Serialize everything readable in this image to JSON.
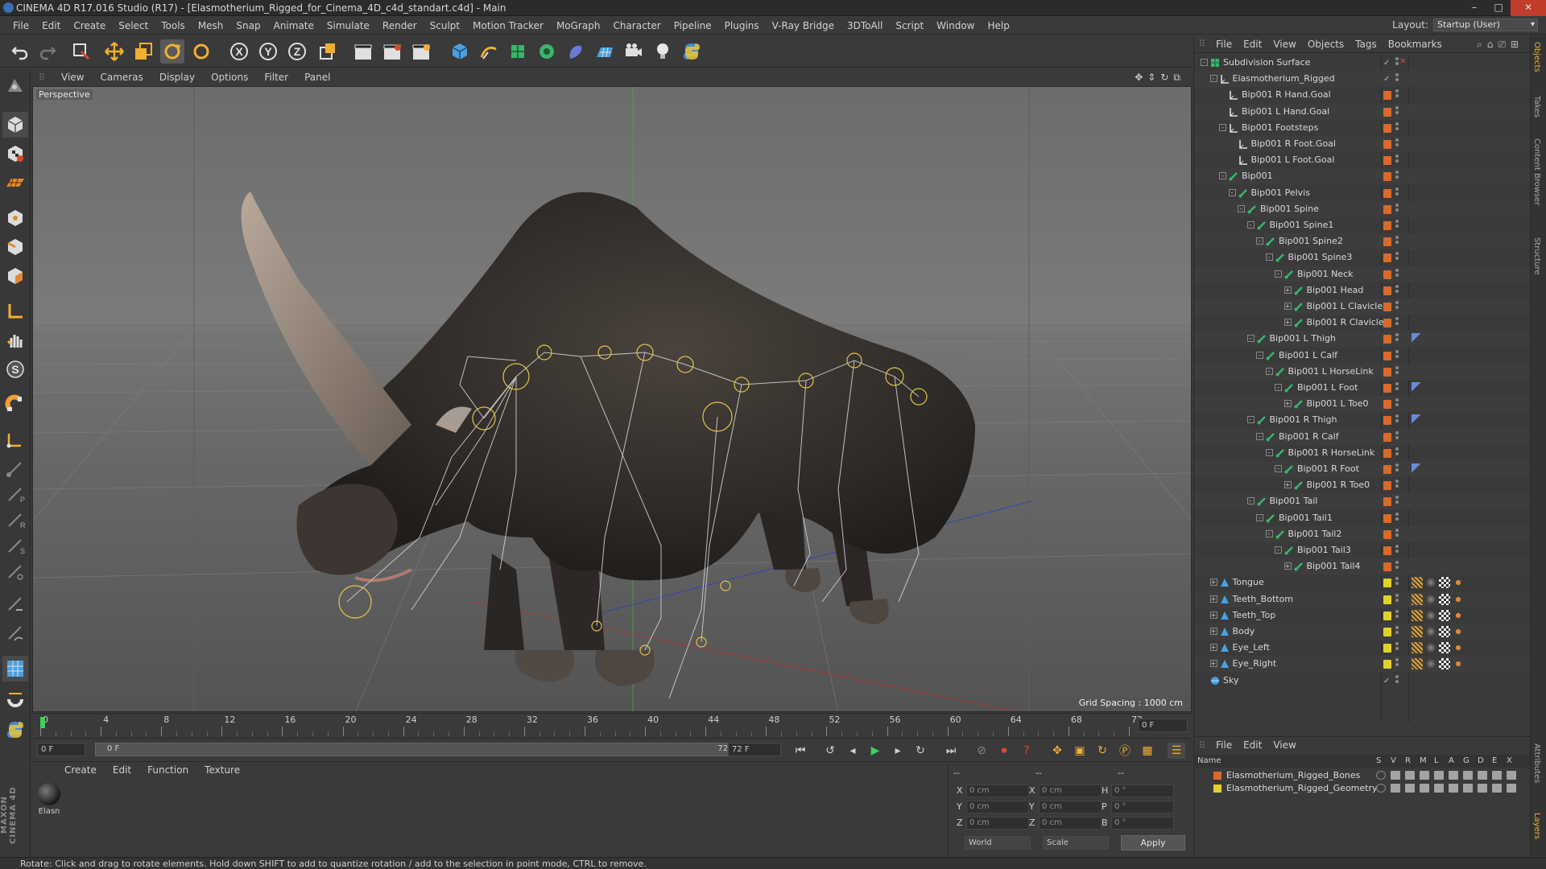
{
  "window": {
    "title": "CINEMA 4D R17.016 Studio (R17) - [Elasmotherium_Rigged_for_Cinema_4D_c4d_standart.c4d] - Main",
    "layout_label": "Layout:",
    "layout_value": "Startup (User)"
  },
  "menubar": [
    "File",
    "Edit",
    "Create",
    "Select",
    "Tools",
    "Mesh",
    "Snap",
    "Animate",
    "Simulate",
    "Render",
    "Sculpt",
    "Motion Tracker",
    "MoGraph",
    "Character",
    "Pipeline",
    "Plugins",
    "V-Ray Bridge",
    "3DToAll",
    "Script",
    "Window",
    "Help"
  ],
  "viewport": {
    "menu": [
      "View",
      "Cameras",
      "Display",
      "Options",
      "Filter",
      "Panel"
    ],
    "label": "Perspective",
    "grid_spacing": "Grid Spacing : 1000 cm"
  },
  "timeline": {
    "ticks": [
      "0",
      "4",
      "8",
      "12",
      "16",
      "20",
      "24",
      "28",
      "32",
      "36",
      "40",
      "44",
      "48",
      "52",
      "56",
      "60",
      "64",
      "68",
      "72"
    ],
    "current_frame_field": "0 F",
    "start_field": "0 F",
    "range_start": "0 F",
    "range_end": "72 F",
    "end_field": "72 F"
  },
  "material_manager": {
    "menu": [
      "Create",
      "Edit",
      "Function",
      "Texture"
    ],
    "material_name": "Elasn"
  },
  "attributes": {
    "header_left": "--",
    "header_mid": "--",
    "header_right": "--",
    "rows": [
      {
        "a": "X",
        "av": "0 cm",
        "b": "X",
        "bv": "0 cm",
        "c": "H",
        "cv": "0 °"
      },
      {
        "a": "Y",
        "av": "0 cm",
        "b": "Y",
        "bv": "0 cm",
        "c": "P",
        "cv": "0 °"
      },
      {
        "a": "Z",
        "av": "0 cm",
        "b": "Z",
        "bv": "0 cm",
        "c": "B",
        "cv": "0 °"
      }
    ],
    "coord_system": "World",
    "mode": "Scale",
    "apply_label": "Apply"
  },
  "object_manager": {
    "menu": [
      "File",
      "Edit",
      "View",
      "Objects",
      "Tags",
      "Bookmarks"
    ],
    "objects": [
      {
        "name": "Subdivision Surface",
        "depth": 0,
        "icon": "subdivision",
        "exp": "-",
        "tag": "check",
        "tagcolor": "#888888"
      },
      {
        "name": "Elasmotherium_Rigged",
        "depth": 1,
        "icon": "null",
        "exp": "-",
        "tag": "check",
        "tagcolor": "#888888"
      },
      {
        "name": "Bip001 R Hand.Goal",
        "depth": 2,
        "icon": "null",
        "exp": "",
        "tag": "layer",
        "tagcolor": "#d96a2a"
      },
      {
        "name": "Bip001 L Hand.Goal",
        "depth": 2,
        "icon": "null",
        "exp": "",
        "tag": "layer",
        "tagcolor": "#d96a2a"
      },
      {
        "name": "Bip001 Footsteps",
        "depth": 2,
        "icon": "null",
        "exp": "-",
        "tag": "layer",
        "tagcolor": "#d96a2a"
      },
      {
        "name": "Bip001 R Foot.Goal",
        "depth": 3,
        "icon": "null",
        "exp": "",
        "tag": "layer",
        "tagcolor": "#d96a2a"
      },
      {
        "name": "Bip001 L Foot.Goal",
        "depth": 3,
        "icon": "null",
        "exp": "",
        "tag": "layer",
        "tagcolor": "#d96a2a"
      },
      {
        "name": "Bip001",
        "depth": 2,
        "icon": "bone",
        "exp": "-",
        "tag": "layer",
        "tagcolor": "#d96a2a"
      },
      {
        "name": "Bip001 Pelvis",
        "depth": 3,
        "icon": "bone",
        "exp": "-",
        "tag": "layer",
        "tagcolor": "#d96a2a"
      },
      {
        "name": "Bip001 Spine",
        "depth": 4,
        "icon": "bone",
        "exp": "-",
        "tag": "layer",
        "tagcolor": "#d96a2a"
      },
      {
        "name": "Bip001 Spine1",
        "depth": 5,
        "icon": "bone",
        "exp": "-",
        "tag": "layer",
        "tagcolor": "#d96a2a"
      },
      {
        "name": "Bip001 Spine2",
        "depth": 6,
        "icon": "bone",
        "exp": "-",
        "tag": "layer",
        "tagcolor": "#d96a2a"
      },
      {
        "name": "Bip001 Spine3",
        "depth": 7,
        "icon": "bone",
        "exp": "-",
        "tag": "layer",
        "tagcolor": "#d96a2a"
      },
      {
        "name": "Bip001 Neck",
        "depth": 8,
        "icon": "bone",
        "exp": "-",
        "tag": "layer",
        "tagcolor": "#d96a2a"
      },
      {
        "name": "Bip001 Head",
        "depth": 9,
        "icon": "bone",
        "exp": "+",
        "tag": "layer",
        "tagcolor": "#d96a2a"
      },
      {
        "name": "Bip001 L Clavicle",
        "depth": 9,
        "icon": "bone",
        "exp": "+",
        "tag": "layer",
        "tagcolor": "#d96a2a"
      },
      {
        "name": "Bip001 R Clavicle",
        "depth": 9,
        "icon": "bone",
        "exp": "+",
        "tag": "layer",
        "tagcolor": "#d96a2a"
      },
      {
        "name": "Bip001 L Thigh",
        "depth": 5,
        "icon": "bone",
        "exp": "-",
        "tag": "layer",
        "tagcolor": "#d96a2a",
        "extra": "ik"
      },
      {
        "name": "Bip001 L Calf",
        "depth": 6,
        "icon": "bone",
        "exp": "-",
        "tag": "layer",
        "tagcolor": "#d96a2a"
      },
      {
        "name": "Bip001 L HorseLink",
        "depth": 7,
        "icon": "bone",
        "exp": "-",
        "tag": "layer",
        "tagcolor": "#d96a2a"
      },
      {
        "name": "Bip001 L Foot",
        "depth": 8,
        "icon": "bone",
        "exp": "-",
        "tag": "layer",
        "tagcolor": "#d96a2a",
        "extra": "ik2"
      },
      {
        "name": "Bip001 L Toe0",
        "depth": 9,
        "icon": "bone",
        "exp": "+",
        "tag": "layer",
        "tagcolor": "#d96a2a"
      },
      {
        "name": "Bip001 R Thigh",
        "depth": 5,
        "icon": "bone",
        "exp": "-",
        "tag": "layer",
        "tagcolor": "#d96a2a",
        "extra": "ik"
      },
      {
        "name": "Bip001 R Calf",
        "depth": 6,
        "icon": "bone",
        "exp": "-",
        "tag": "layer",
        "tagcolor": "#d96a2a"
      },
      {
        "name": "Bip001 R HorseLink",
        "depth": 7,
        "icon": "bone",
        "exp": "-",
        "tag": "layer",
        "tagcolor": "#d96a2a"
      },
      {
        "name": "Bip001 R Foot",
        "depth": 8,
        "icon": "bone",
        "exp": "-",
        "tag": "layer",
        "tagcolor": "#d96a2a",
        "extra": "ik2"
      },
      {
        "name": "Bip001 R Toe0",
        "depth": 9,
        "icon": "bone",
        "exp": "+",
        "tag": "layer",
        "tagcolor": "#d96a2a"
      },
      {
        "name": "Bip001 Tail",
        "depth": 5,
        "icon": "bone",
        "exp": "-",
        "tag": "layer",
        "tagcolor": "#d96a2a"
      },
      {
        "name": "Bip001 Tail1",
        "depth": 6,
        "icon": "bone",
        "exp": "-",
        "tag": "layer",
        "tagcolor": "#d96a2a"
      },
      {
        "name": "Bip001 Tail2",
        "depth": 7,
        "icon": "bone",
        "exp": "-",
        "tag": "layer",
        "tagcolor": "#d96a2a"
      },
      {
        "name": "Bip001 Tail3",
        "depth": 8,
        "icon": "bone",
        "exp": "-",
        "tag": "layer",
        "tagcolor": "#d96a2a"
      },
      {
        "name": "Bip001 Tail4",
        "depth": 9,
        "icon": "bone",
        "exp": "+",
        "tag": "layer",
        "tagcolor": "#d96a2a"
      },
      {
        "name": "Tongue",
        "depth": 1,
        "icon": "mesh",
        "exp": "+",
        "tag": "layer",
        "tagcolor": "#e0d22a",
        "extra": "mat"
      },
      {
        "name": "Teeth_Bottom",
        "depth": 1,
        "icon": "mesh",
        "exp": "+",
        "tag": "layer",
        "tagcolor": "#e0d22a",
        "extra": "mat"
      },
      {
        "name": "Teeth_Top",
        "depth": 1,
        "icon": "mesh",
        "exp": "+",
        "tag": "layer",
        "tagcolor": "#e0d22a",
        "extra": "mat"
      },
      {
        "name": "Body",
        "depth": 1,
        "icon": "mesh",
        "exp": "+",
        "tag": "layer",
        "tagcolor": "#e0d22a",
        "extra": "mat"
      },
      {
        "name": "Eye_Left",
        "depth": 1,
        "icon": "mesh",
        "exp": "+",
        "tag": "layer",
        "tagcolor": "#e0d22a",
        "extra": "mat"
      },
      {
        "name": "Eye_Right",
        "depth": 1,
        "icon": "mesh",
        "exp": "+",
        "tag": "layer",
        "tagcolor": "#e0d22a",
        "extra": "mat"
      },
      {
        "name": "Sky",
        "depth": 0,
        "icon": "sky",
        "exp": "",
        "tag": "check",
        "tagcolor": "#888888"
      }
    ]
  },
  "layer_manager": {
    "menu": [
      "File",
      "Edit",
      "View"
    ],
    "name_header": "Name",
    "columns": [
      "S",
      "V",
      "R",
      "M",
      "L",
      "A",
      "G",
      "D",
      "E",
      "X"
    ],
    "layers": [
      {
        "name": "Elasmotherium_Rigged_Bones",
        "color": "#d96a2a"
      },
      {
        "name": "Elasmotherium_Rigged_Geometry",
        "color": "#e0d22a"
      }
    ]
  },
  "side_tabs": [
    "Objects",
    "Takes",
    "Content Browser",
    "Structure"
  ],
  "side_tabs_bottom": [
    "Attributes",
    "Layers"
  ],
  "logo": "MAXON CINEMA 4D",
  "status": "Rotate: Click and drag to rotate elements. Hold down SHIFT to add to quantize rotation / add to the selection in point mode, CTRL to remove."
}
